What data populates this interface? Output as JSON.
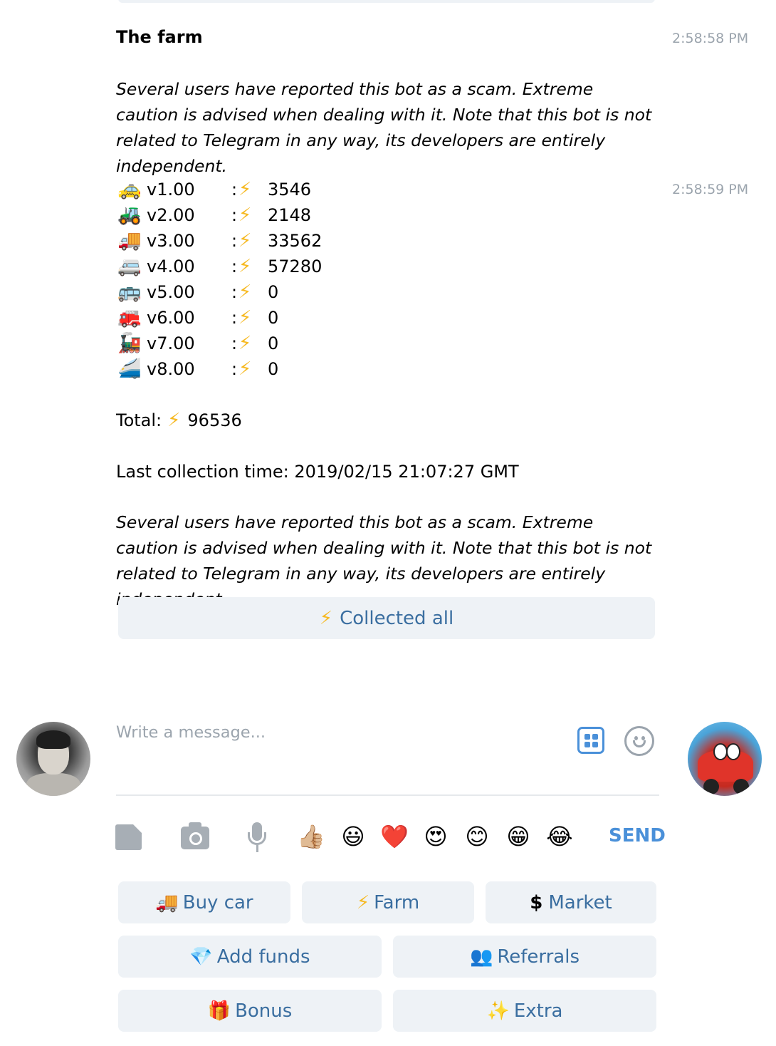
{
  "message": {
    "sender": "The farm",
    "time_first": "2:58:58 PM",
    "time_second": "2:58:59 PM",
    "warning": "Several users have reported this bot as a scam. Extreme caution is advised when dealing with it. Note that this bot is not related to Telegram in any way, its developers are entirely independent.",
    "rows": [
      {
        "emoji": "🚕",
        "version": "v1.00",
        "colon": ":",
        "bolt": "⚡",
        "value": "3546"
      },
      {
        "emoji": "🚜",
        "version": "v2.00",
        "colon": ":",
        "bolt": "⚡",
        "value": "2148"
      },
      {
        "emoji": "🚚",
        "version": "v3.00",
        "colon": ":",
        "bolt": "⚡",
        "value": "33562"
      },
      {
        "emoji": "🚐",
        "version": "v4.00",
        "colon": ":",
        "bolt": "⚡",
        "value": "57280"
      },
      {
        "emoji": "🚌",
        "version": "v5.00",
        "colon": ":",
        "bolt": "⚡",
        "value": "0"
      },
      {
        "emoji": "🚒",
        "version": "v6.00",
        "colon": ":",
        "bolt": "⚡",
        "value": "0"
      },
      {
        "emoji": "🚂",
        "version": "v7.00",
        "colon": ":",
        "bolt": "⚡",
        "value": "0"
      },
      {
        "emoji": "🚄",
        "version": "v8.00",
        "colon": ":",
        "bolt": "⚡",
        "value": "0"
      }
    ],
    "total_label": "Total:",
    "total_bolt": "⚡",
    "total_value": "96536",
    "collection_time": "Last collection time: 2019/02/15 21:07:27 GMT",
    "inline_button": {
      "icon": "⚡",
      "label": "Collected all"
    }
  },
  "composer": {
    "placeholder": "Write a message...",
    "quick_emojis": [
      "👍🏼",
      "😃",
      "❤️",
      "😍",
      "😊",
      "😁",
      "😂"
    ],
    "send_label": "SEND"
  },
  "keyboard": {
    "buy_car": {
      "icon": "🚚",
      "label": "Buy car"
    },
    "farm": {
      "icon": "⚡",
      "label": "Farm"
    },
    "market": {
      "icon": "$",
      "label": "Market"
    },
    "add_funds": {
      "icon": "💎",
      "label": "Add funds"
    },
    "referrals": {
      "icon": "👥",
      "label": "Referrals"
    },
    "bonus": {
      "icon": "🎁",
      "label": "Bonus"
    },
    "extra": {
      "icon": "✨",
      "label": "Extra"
    }
  },
  "colors": {
    "accent": "#4a90d9",
    "button_bg": "#eef2f6",
    "button_text": "#3a6ea0",
    "muted": "#9ba4ad",
    "bolt": "#f6b921"
  }
}
